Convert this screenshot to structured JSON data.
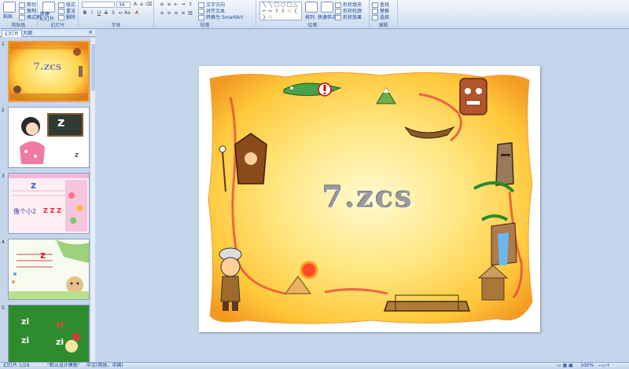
{
  "ribbon": {
    "clipboard": {
      "paste_label": "粘贴",
      "cut_label": "剪切",
      "copy_label": "复制",
      "format_painter_label": "格式刷",
      "group_label": "剪贴板"
    },
    "slides": {
      "new_slide_label": "新建\n幻灯片",
      "layout_label": "版式",
      "reset_label": "重设",
      "delete_label": "删除",
      "group_label": "幻灯片"
    },
    "font": {
      "font_size_value": "36",
      "group_label": "字体"
    },
    "paragraph": {
      "text_direction_label": "文字方向",
      "align_text_label": "对齐文本",
      "smartart_label": "转换为 SmartArt",
      "group_label": "段落"
    },
    "drawing": {
      "arrange_label": "排列",
      "quick_styles_label": "快速样式",
      "shape_fill_label": "形状填充",
      "shape_outline_label": "形状轮廓",
      "shape_effects_label": "形状效果",
      "group_label": "绘图"
    },
    "editing": {
      "find_label": "查找",
      "replace_label": "替换",
      "select_label": "选择",
      "group_label": "编辑"
    }
  },
  "pane": {
    "tabs": [
      "幻灯片",
      "大纲"
    ],
    "close_label": "×",
    "thumbs": [
      {
        "num": "1",
        "title": "7.zcs"
      },
      {
        "num": "2",
        "letter": "z",
        "small": "z"
      },
      {
        "num": "3",
        "letter": "z",
        "caption": "像个小2",
        "zzz": "Z Z Z"
      },
      {
        "num": "4",
        "letter": "z"
      },
      {
        "num": "5",
        "lines": [
          "zi",
          "zi",
          "zi",
          "zi"
        ]
      }
    ]
  },
  "slide": {
    "title": "7.zcs"
  },
  "status": {
    "slide_info": "幻灯片 1/29",
    "theme": "\"默认设计模板\"",
    "language": "中文(简体，中国)",
    "zoom": "100%"
  },
  "colors": {
    "ribbon_bg": "#dbe6f5",
    "workspace_bg": "#c5d5ec",
    "selection": "#f0a030"
  }
}
